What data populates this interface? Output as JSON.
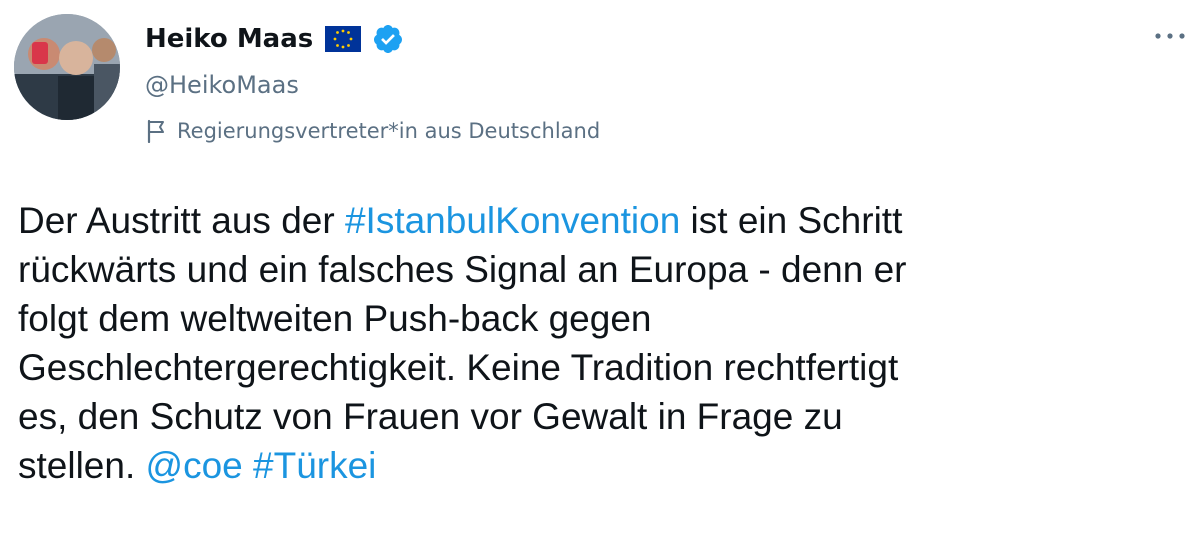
{
  "author": {
    "display_name": "Heiko Maas",
    "handle": "@HeikoMaas",
    "affiliation_label": "Regierungsvertreter*in aus Deutschland"
  },
  "icons": {
    "flag_badge": "eu-flag-icon",
    "verified": "verified-badge-icon",
    "more": "more-horizontal-icon",
    "label": "flag-outline-icon"
  },
  "colors": {
    "link": "#1b95e0",
    "verified": "#1da1f2",
    "secondary_text": "#5b7083",
    "eu_blue": "#003399",
    "eu_star": "#ffcc00"
  },
  "tweet": {
    "line1_pre": "Der Austritt aus der ",
    "hashtag_istanbul": "#IstanbulKonvention",
    "line1_post": " ist ein Schritt",
    "line2": "rückwärts und ein falsches Signal an Europa - denn er",
    "line3": "folgt dem weltweiten Push-back gegen",
    "line4": "Geschlechtergerechtigkeit. Keine Tradition rechtfertigt",
    "line5": "es, den Schutz von Frauen vor Gewalt in Frage zu",
    "line6_pre": "stellen. ",
    "mention_coe": "@coe",
    "hashtag_tuerkei": "#Türkei"
  }
}
